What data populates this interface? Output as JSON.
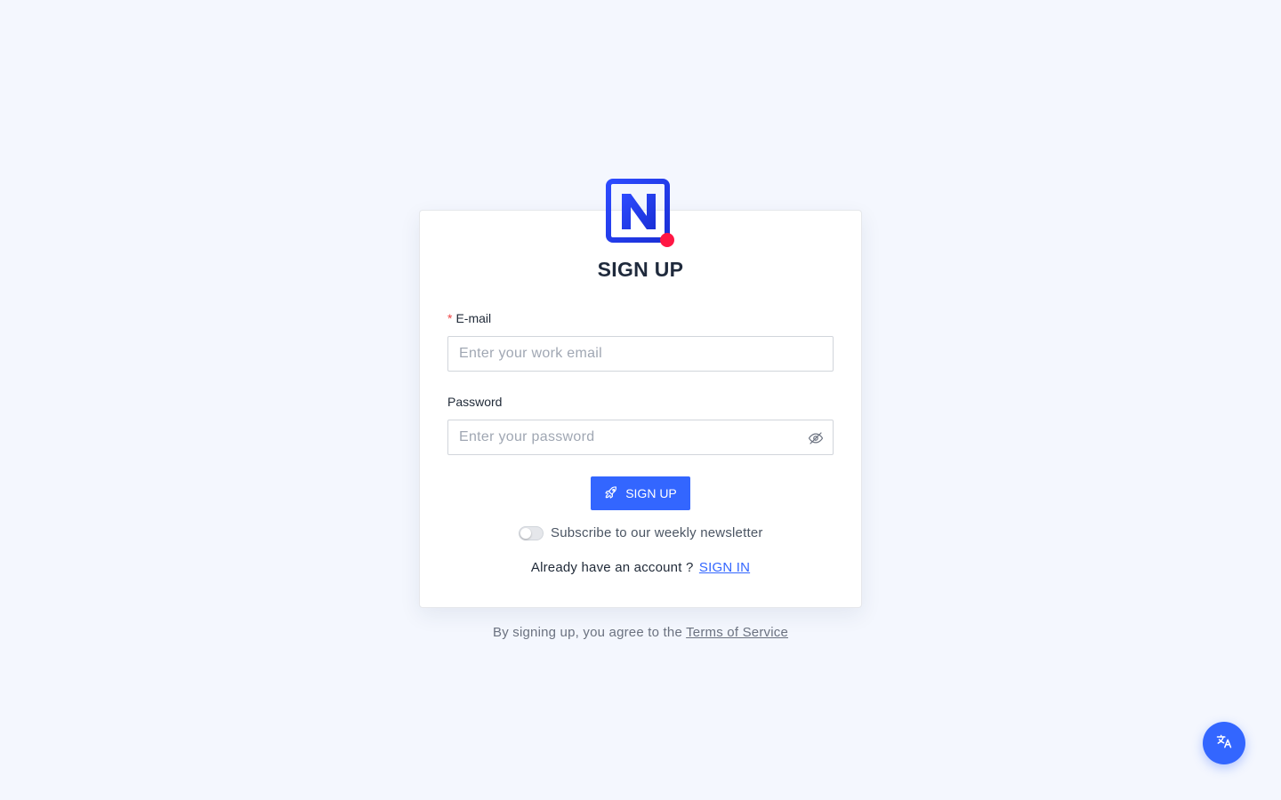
{
  "brand": {
    "logo_icon": "n-logo-icon",
    "primary_color": "#3366ff",
    "logo_blue": "#2137e8",
    "logo_dot": "#ff1744"
  },
  "form": {
    "title": "SIGN UP",
    "email": {
      "required_mark": "*",
      "label": "E-mail",
      "placeholder": "Enter your work email",
      "value": ""
    },
    "password": {
      "label": "Password",
      "placeholder": "Enter your password",
      "value": "",
      "toggle_icon": "eye-off-icon"
    },
    "submit": {
      "label": "SIGN UP",
      "icon": "rocket-icon"
    },
    "newsletter": {
      "label": "Subscribe to our weekly newsletter",
      "checked": false
    },
    "signin": {
      "prompt": "Already have an account ?",
      "link": "SIGN IN"
    }
  },
  "footer": {
    "terms_prefix": "By signing up, you agree to the",
    "terms_link": "Terms of Service"
  },
  "language_button": {
    "icon": "translate-icon"
  }
}
